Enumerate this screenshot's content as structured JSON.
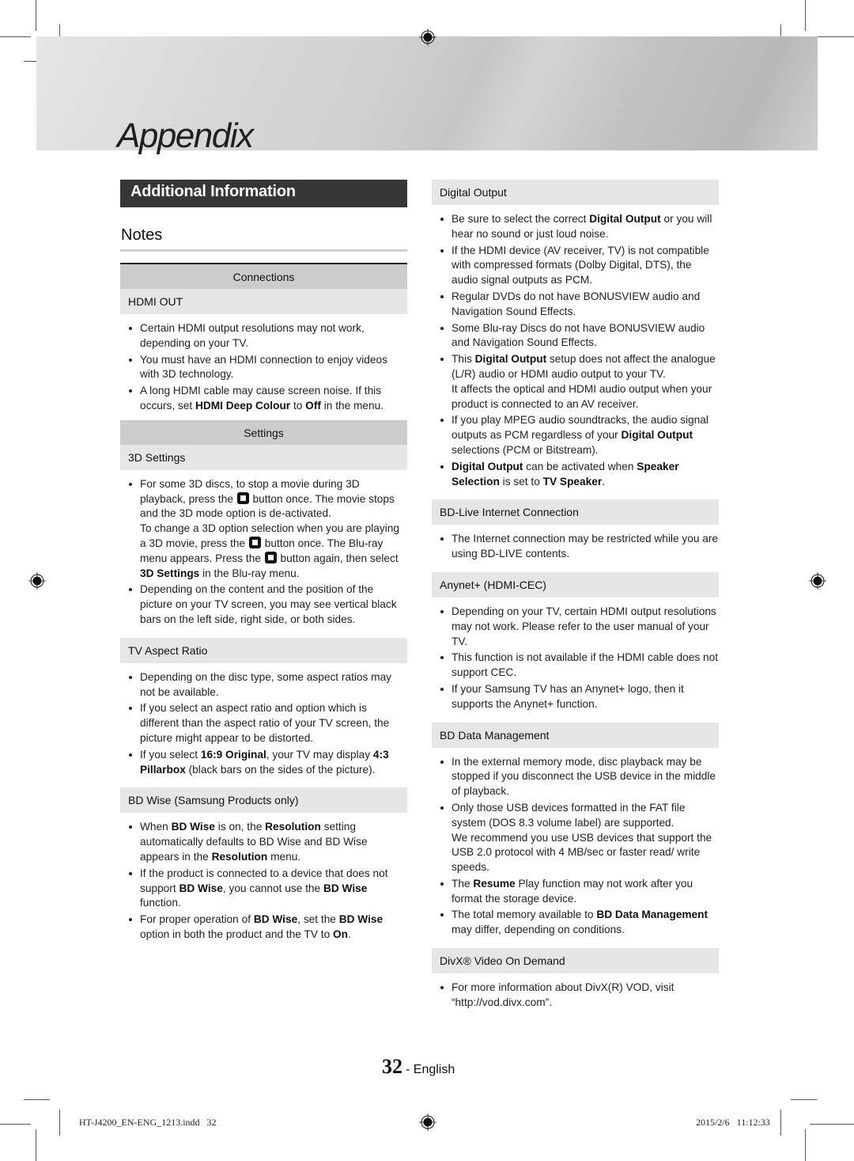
{
  "header": {
    "title": "Appendix"
  },
  "section": {
    "title": "Additional Information"
  },
  "notes": {
    "heading": "Notes"
  },
  "left_column": {
    "groups": [
      {
        "category": "Connections",
        "subsections": [
          {
            "title": "HDMI OUT",
            "bullets": [
              [
                {
                  "t": "Certain HDMI output resolutions may not work, depending on your TV."
                }
              ],
              [
                {
                  "t": "You must have an HDMI connection to enjoy videos with 3D technology."
                }
              ],
              [
                {
                  "t": "A long HDMI cable may cause screen noise. If this occurs, set "
                },
                {
                  "b": "HDMI Deep Colour"
                },
                {
                  "t": " to "
                },
                {
                  "b": "Off"
                },
                {
                  "t": " in the menu."
                }
              ]
            ]
          }
        ]
      },
      {
        "category": "Settings",
        "subsections": [
          {
            "title": "3D Settings",
            "bullets": [
              [
                {
                  "t": "For some 3D discs, to stop a movie during 3D playback, press the "
                },
                {
                  "icon": "stop-button-icon"
                },
                {
                  "t": " button once. The movie stops and the 3D mode option is de-activated."
                },
                {
                  "br": true
                },
                {
                  "t": "To change a 3D option selection when you are playing a 3D movie, press the "
                },
                {
                  "icon": "stop-button-icon"
                },
                {
                  "t": " button once. The Blu-ray menu appears. Press the "
                },
                {
                  "icon": "stop-button-icon"
                },
                {
                  "t": " button again, then select "
                },
                {
                  "b": "3D Settings"
                },
                {
                  "t": " in the Blu-ray menu."
                }
              ],
              [
                {
                  "t": "Depending on the content and the position of the picture on your TV screen, you may see vertical black bars on the left side, right side, or both sides."
                }
              ]
            ]
          },
          {
            "title": "TV Aspect Ratio",
            "bullets": [
              [
                {
                  "t": "Depending on the disc type, some aspect ratios may not be available."
                }
              ],
              [
                {
                  "t": "If you select an aspect ratio and option which is different than the aspect ratio of your TV screen, the picture might appear to be distorted."
                }
              ],
              [
                {
                  "t": "If you select "
                },
                {
                  "b": "16:9 Original"
                },
                {
                  "t": ", your TV may display "
                },
                {
                  "b": "4:3 Pillarbox"
                },
                {
                  "t": " (black bars on the sides of the picture)."
                }
              ]
            ]
          },
          {
            "title": "BD Wise (Samsung Products only)",
            "bullets": [
              [
                {
                  "t": "When "
                },
                {
                  "b": "BD Wise"
                },
                {
                  "t": " is on, the "
                },
                {
                  "b": "Resolution"
                },
                {
                  "t": " setting automatically defaults to BD Wise and BD Wise appears in the "
                },
                {
                  "b": "Resolution"
                },
                {
                  "t": " menu."
                }
              ],
              [
                {
                  "t": "If the product is connected to a device that does not support "
                },
                {
                  "b": "BD Wise"
                },
                {
                  "t": ", you cannot use the "
                },
                {
                  "b": "BD Wise"
                },
                {
                  "t": " function."
                }
              ],
              [
                {
                  "t": "For proper operation of "
                },
                {
                  "b": "BD Wise"
                },
                {
                  "t": ", set the "
                },
                {
                  "b": "BD Wise"
                },
                {
                  "t": " option in both the product and the TV to "
                },
                {
                  "b": "On"
                },
                {
                  "t": "."
                }
              ]
            ]
          }
        ]
      }
    ]
  },
  "right_column": {
    "subsections": [
      {
        "title": "Digital Output",
        "bullets": [
          [
            {
              "t": "Be sure to select the correct "
            },
            {
              "b": "Digital Output"
            },
            {
              "t": " or you will hear no sound or just loud noise."
            }
          ],
          [
            {
              "t": "If the HDMI device (AV receiver, TV) is not compatible with compressed formats (Dolby Digital, DTS), the audio signal outputs as PCM."
            }
          ],
          [
            {
              "t": "Regular DVDs do not have BONUSVIEW audio and Navigation Sound Effects."
            }
          ],
          [
            {
              "t": "Some Blu-ray Discs do not have BONUSVIEW audio and Navigation Sound Effects."
            }
          ],
          [
            {
              "t": "This "
            },
            {
              "b": "Digital Output"
            },
            {
              "t": " setup does not affect the analogue (L/R) audio or HDMI audio output to your TV."
            },
            {
              "br": true
            },
            {
              "t": "It affects the optical and HDMI audio output when your product is connected to an AV receiver."
            }
          ],
          [
            {
              "t": "If you play MPEG audio soundtracks, the audio signal outputs as PCM regardless of your "
            },
            {
              "b": "Digital Output"
            },
            {
              "t": " selections (PCM or Bitstream)."
            }
          ],
          [
            {
              "b": "Digital Output"
            },
            {
              "t": " can be activated when "
            },
            {
              "b": "Speaker Selection"
            },
            {
              "t": " is set to "
            },
            {
              "b": "TV Speaker"
            },
            {
              "t": "."
            }
          ]
        ]
      },
      {
        "title": "BD-Live Internet Connection",
        "bullets": [
          [
            {
              "t": "The Internet connection may be restricted while you are using BD-LIVE contents."
            }
          ]
        ]
      },
      {
        "title": "Anynet+ (HDMI-CEC)",
        "bullets": [
          [
            {
              "t": "Depending on your TV, certain HDMI output resolutions may not work. Please refer to the user manual of your TV."
            }
          ],
          [
            {
              "t": "This function is not available if the HDMI cable does not support CEC."
            }
          ],
          [
            {
              "t": "If your Samsung TV has an Anynet+ logo, then it supports the Anynet+ function."
            }
          ]
        ]
      },
      {
        "title": "BD Data Management",
        "bullets": [
          [
            {
              "t": "In the external memory mode, disc playback may be stopped if you disconnect the USB device in the middle of playback."
            }
          ],
          [
            {
              "t": "Only those USB devices formatted in the FAT file system (DOS 8.3 volume label) are supported."
            },
            {
              "br": true
            },
            {
              "t": "We recommend you use USB devices that support the USB 2.0 protocol with 4 MB/sec or faster read/ write speeds."
            }
          ],
          [
            {
              "t": "The "
            },
            {
              "b": "Resume"
            },
            {
              "t": " Play function may not work after you format the storage device."
            }
          ],
          [
            {
              "t": "The total memory available to "
            },
            {
              "b": "BD Data Management"
            },
            {
              "t": " may differ, depending on conditions."
            }
          ]
        ]
      },
      {
        "title": "DivX® Video On Demand",
        "bullets": [
          [
            {
              "t": "For more information about DivX(R) VOD, visit “http://vod.divx.com”."
            }
          ]
        ]
      }
    ]
  },
  "footer": {
    "page_number": "32",
    "language": "- English",
    "file_slug": "HT-J4200_EN-ENG_1213.indd   32",
    "timestamp": "2015/2/6   11:12:33"
  }
}
